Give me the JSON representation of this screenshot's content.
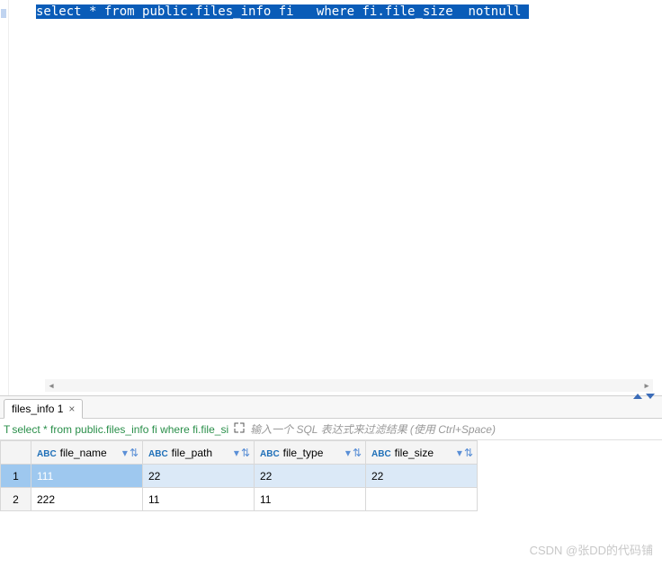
{
  "editor": {
    "sql_tokens": [
      {
        "t": "select",
        "cls": "kw"
      },
      {
        "t": " * ",
        "cls": ""
      },
      {
        "t": "from",
        "cls": "kw"
      },
      {
        "t": " public.files_info fi   ",
        "cls": ""
      },
      {
        "t": "where",
        "cls": "kw"
      },
      {
        "t": " fi.file_size  ",
        "cls": ""
      },
      {
        "t": "notnull",
        "cls": "kw"
      },
      {
        "t": " ",
        "cls": ""
      }
    ]
  },
  "tab": {
    "label": "files_info 1",
    "close": "×"
  },
  "query_bar": {
    "query_prefix": "T ",
    "query_text": "select * from public.files_info fi where fi.file_si",
    "filter_placeholder": "输入一个 SQL 表达式来过滤结果 (使用 Ctrl+Space)"
  },
  "columns": [
    {
      "type": "ABC",
      "name": "file_name"
    },
    {
      "type": "ABC",
      "name": "file_path"
    },
    {
      "type": "ABC",
      "name": "file_type"
    },
    {
      "type": "ABC",
      "name": "file_size"
    }
  ],
  "rows": [
    {
      "num": "1",
      "selected": true,
      "cells": [
        "111",
        "22",
        "22",
        "22"
      ]
    },
    {
      "num": "2",
      "selected": false,
      "cells": [
        "222",
        "11",
        "11",
        ""
      ]
    }
  ],
  "watermark": "CSDN @张DD的代码铺"
}
